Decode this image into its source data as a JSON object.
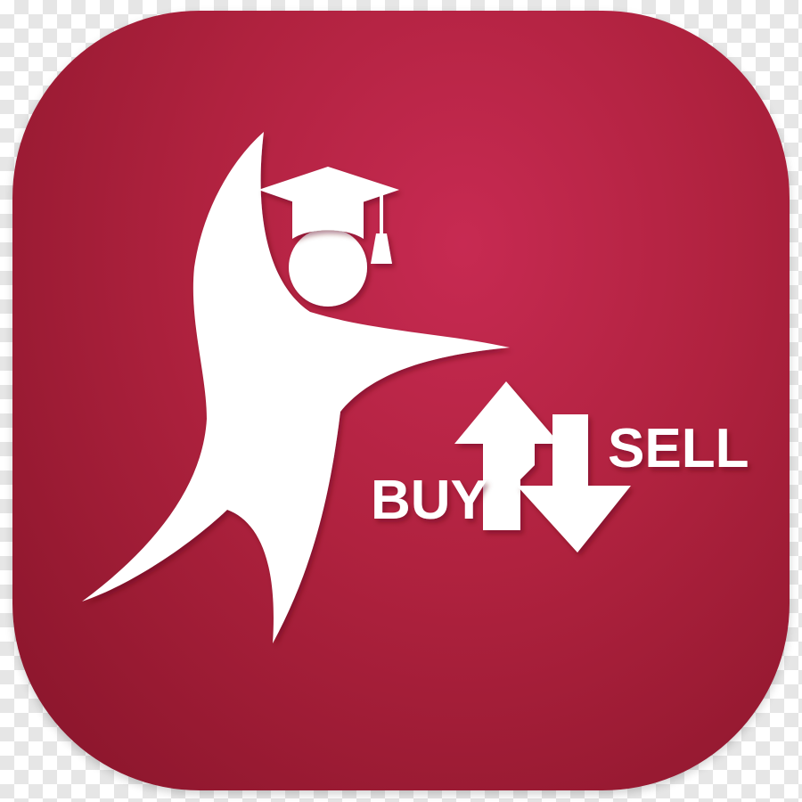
{
  "app_icon": {
    "buy_label": "BUY",
    "sell_label": "SELL",
    "colors": {
      "background": "#b0223f",
      "foreground": "#ffffff"
    },
    "icons": [
      "student-figure-icon",
      "graduation-cap-icon",
      "buy-arrow-up-icon",
      "sell-arrow-down-icon"
    ]
  }
}
